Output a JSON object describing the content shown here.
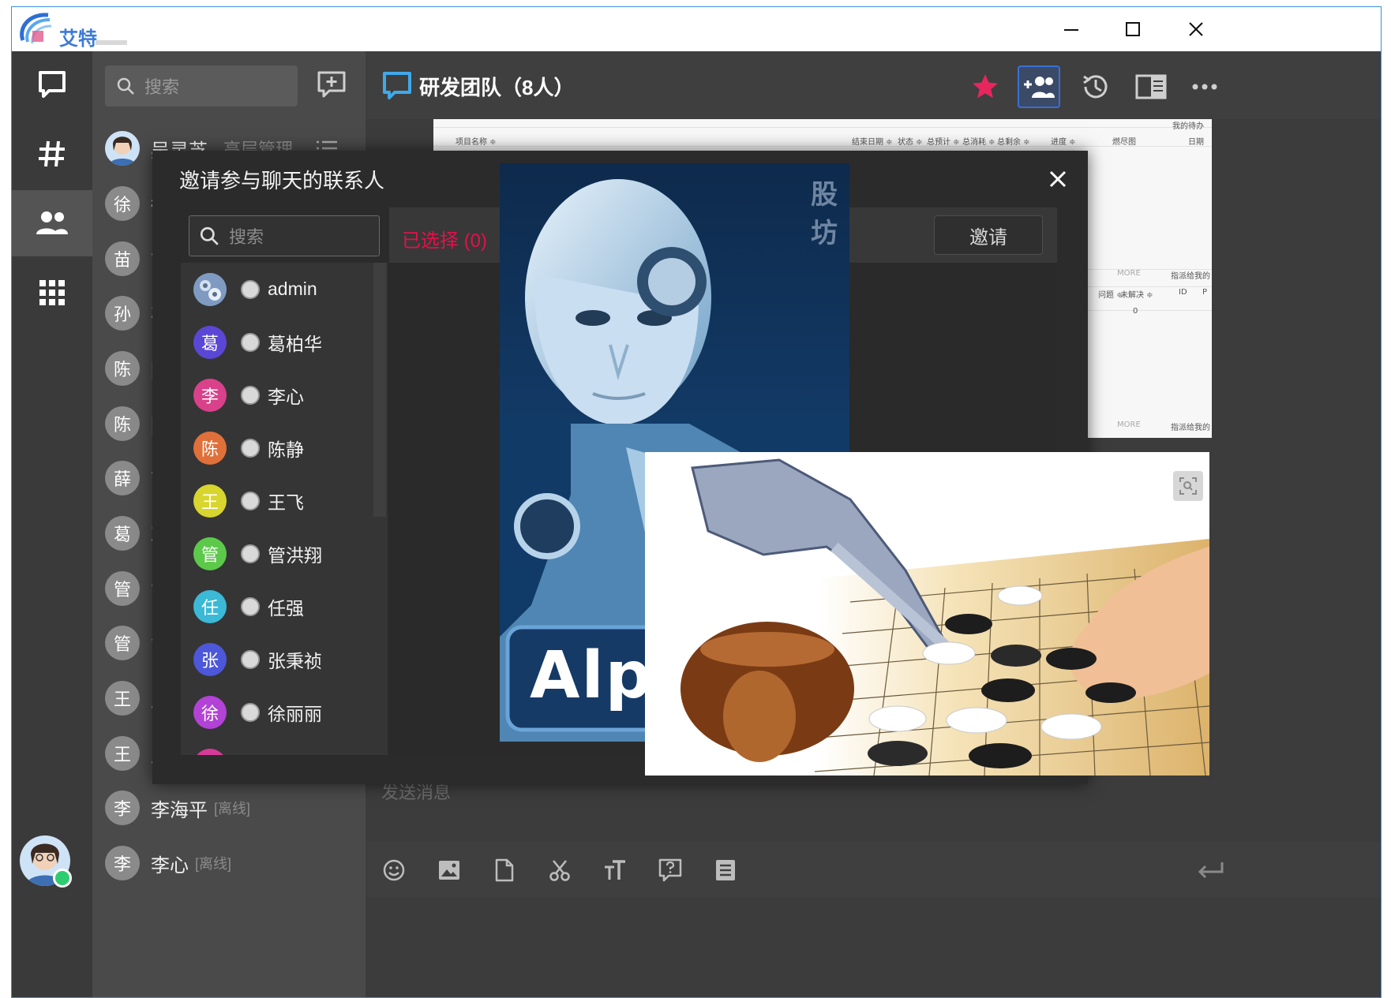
{
  "app": {
    "logo_text": "艾特"
  },
  "window_controls": [
    "minimize",
    "maximize",
    "close"
  ],
  "iconbar": {
    "items": [
      {
        "name": "chat",
        "icon": "chat-bubble-icon"
      },
      {
        "name": "channels",
        "icon": "hash-icon"
      },
      {
        "name": "contacts",
        "icon": "people-icon",
        "active": true
      },
      {
        "name": "apps",
        "icon": "grid-icon"
      }
    ],
    "online_status_color": "#2ecc71"
  },
  "sidebar": {
    "search_placeholder": "搜索",
    "contacts": [
      {
        "initial": "",
        "name": "吴灵芝",
        "role": "高层管理"
      },
      {
        "initial": "徐",
        "name": "徐"
      },
      {
        "initial": "苗",
        "name": "苗"
      },
      {
        "initial": "孙",
        "name": "孙"
      },
      {
        "initial": "陈",
        "name": "陈"
      },
      {
        "initial": "陈",
        "name": "陈"
      },
      {
        "initial": "薛",
        "name": "薛"
      },
      {
        "initial": "葛",
        "name": "葛"
      },
      {
        "initial": "管",
        "name": "管"
      },
      {
        "initial": "管",
        "name": "管"
      },
      {
        "initial": "王",
        "name": "王"
      },
      {
        "initial": "王",
        "name": "王"
      },
      {
        "initial": "李",
        "name": "李海平",
        "status": "[离线]"
      },
      {
        "initial": "李",
        "name": "李心",
        "status": "[离线]"
      }
    ]
  },
  "chat": {
    "title": "研发团队（8人）",
    "input_placeholder": "发送消息",
    "accent": "#e8265e",
    "doc_preview": {
      "columns": [
        "项目名称 ≑",
        "结束日期 ≑",
        "状态 ≑",
        "总预计 ≑",
        "总消耗 ≑",
        "总剩余 ≑",
        "进度 ≑",
        "燃尽图"
      ],
      "side_columns": [
        "日期"
      ],
      "side_headers": [
        "我的待办",
        "指派给我的",
        "指派给我的"
      ],
      "more_label": "MORE",
      "problem_cols": [
        "问题 ≑",
        "未解决 ≑"
      ],
      "id_cols": [
        "ID",
        "P"
      ],
      "zero": "0"
    }
  },
  "modal": {
    "title": "邀请参与聊天的联系人",
    "search_placeholder": "搜索",
    "selected_label": "已选择 (0)",
    "invite_label": "邀请",
    "members": [
      {
        "initial": "",
        "name": "admin",
        "color": "#5a6e8c"
      },
      {
        "initial": "葛",
        "name": "葛柏华",
        "color": "#5b47d6"
      },
      {
        "initial": "李",
        "name": "李心",
        "color": "#d9418b"
      },
      {
        "initial": "陈",
        "name": "陈静",
        "color": "#e0703a"
      },
      {
        "initial": "王",
        "name": "王飞",
        "color": "#d7d52e"
      },
      {
        "initial": "管",
        "name": "管洪翔",
        "color": "#5cc94a"
      },
      {
        "initial": "任",
        "name": "任强",
        "color": "#3bb9d6"
      },
      {
        "initial": "张",
        "name": "张秉祯",
        "color": "#4d57d9"
      },
      {
        "initial": "徐",
        "name": "徐丽丽",
        "color": "#b342d6"
      },
      {
        "initial": "",
        "name": "",
        "color": "#d63b9a"
      }
    ]
  },
  "overlays": {
    "robot_label": "股坊",
    "robot_logo": "Alpl"
  }
}
